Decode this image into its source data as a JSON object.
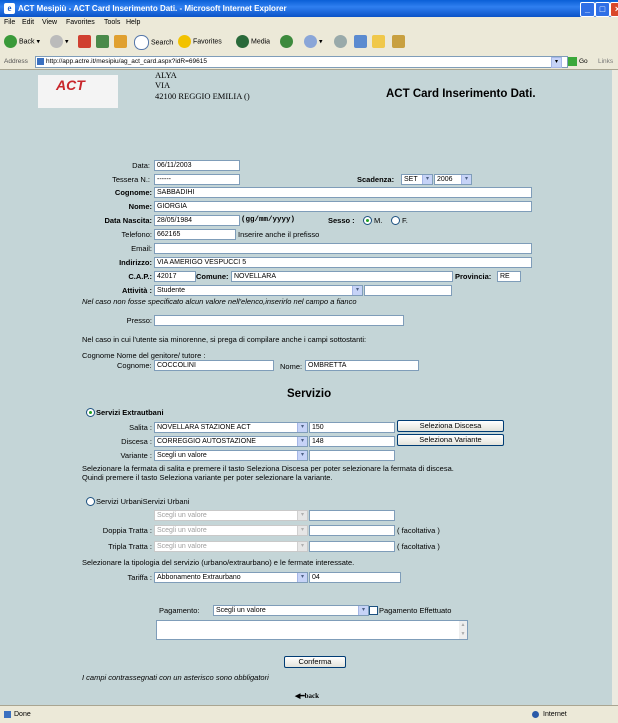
{
  "window": {
    "title": "ACT Mesipiù - ACT Card Inserimento Dati. - Microsoft Internet Explorer",
    "ie_glyph": "e"
  },
  "menu": [
    "File",
    "Edit",
    "View",
    "Favorites",
    "Tools",
    "Help"
  ],
  "toolbar": {
    "back": "Back",
    "search": "Search",
    "favorites": "Favorites",
    "media": "Media"
  },
  "address": {
    "label": "Address",
    "url": "http://app.actre.it/mesipiu/ag_act_card.aspx?idR=69615",
    "go": "Go",
    "links": "Links"
  },
  "status": {
    "left": "Done",
    "right": "Internet"
  },
  "header": {
    "logo": "ACT",
    "name": "ALYA",
    "street": "VIA",
    "city": "42100 REGGIO EMILIA ()",
    "title": "ACT Card Inserimento Dati."
  },
  "form": {
    "data_label": "Data:",
    "data_value": "06/11/2003",
    "tessera_label": "Tessera N.:",
    "tessera_value": "------",
    "scadenza_label": "Scadenza:",
    "scadenza_month": "SET",
    "scadenza_year": "2006",
    "cognome_label": "Cognome:",
    "cognome_value": "SABBADIHI",
    "nome_label": "Nome:",
    "nome_value": "GIORGIA",
    "nascita_label": "Data Nascita:",
    "nascita_value": "28/05/1984",
    "nascita_hint": "(gg/mm/yyyy)",
    "sesso_label": "Sesso :",
    "sesso_m": "M.",
    "sesso_f": "F.",
    "telefono_label": "Telefono:",
    "telefono_value": "662165",
    "telefono_hint": "Inserire anche il prefisso",
    "email_label": "Email:",
    "email_value": "",
    "indirizzo_label": "Indirizzo:",
    "indirizzo_value": "VIA AMERIGO VESPUCCI 5",
    "cap_label": "C.A.P.:",
    "cap_value": "42017",
    "comune_label": "Comune:",
    "comune_value": "NOVELLARA",
    "provincia_label": "Provincia:",
    "provincia_value": "RE",
    "attivita_label": "Attività :",
    "attivita_value": "Studente",
    "attivita_other": "",
    "attivita_note": "Nel caso non fosse specificato alcun valore nell'elenco,inserirlo nel campo a fianco",
    "presso_label": "Presso:",
    "presso_value": "",
    "minor_note": "Nel caso in cui l'utente sia minorenne, si prega di compilare anche i campi sottostanti:",
    "genitore_label": "Cognome Nome del genitore/ tutore :",
    "gen_cognome_label": "Cognome:",
    "gen_cognome_value": "COCCOLINI",
    "gen_nome_label": "Nome:",
    "gen_nome_value": "OMBRETTA"
  },
  "servizio": {
    "title": "Servizio",
    "extra_label": "Servizi Extrautbani",
    "salita_label": "Salita :",
    "salita_value": "NOVELLARA STAZIONE ACT",
    "salita_code": "150",
    "salita_button": "Seleziona Discesa",
    "discesa_label": "Discesa :",
    "discesa_value": "CORREGGIO AUTOSTAZIONE",
    "discesa_code": "148",
    "discesa_button": "Seleziona Variante",
    "variante_label": "Variante :",
    "variante_value": "Scegli un valore",
    "variante_code": "",
    "extra_note1": "Selezionare la fermata di salita e premere il tasto Seleziona Discesa per poter selezionare la fermata di discesa.",
    "extra_note2": "Quindi premere il tasto Seleziona variante per poter selezionare la variante.",
    "urbani_label": "Servizi UrbaniServizi Urbani",
    "urbani_value": "Scegli un valore",
    "doppia_label": "Doppia Tratta :",
    "doppia_value": "Scegli un valore",
    "doppia_hint": "( facoltativa )",
    "tripla_label": "Tripla Tratta :",
    "tripla_value": "Scegli un valore",
    "tripla_hint": "( facoltativa )",
    "tipologia_note": "Selezionare la tipologia del servizio (urbano/extraurbano) e le fermate interessate.",
    "tariffa_label": "Tariffa :",
    "tariffa_value": "Abbonamento Extraurbano",
    "tariffa_code": "04",
    "pagamento_label": "Pagamento:",
    "pagamento_value": "Scegli un valore",
    "pagamento_check": "Pagamento Effettuato",
    "conferma": "Conferma",
    "obbligatori": "I campi contrassegnati con un asterisco sono obbligatori",
    "back": "back"
  }
}
